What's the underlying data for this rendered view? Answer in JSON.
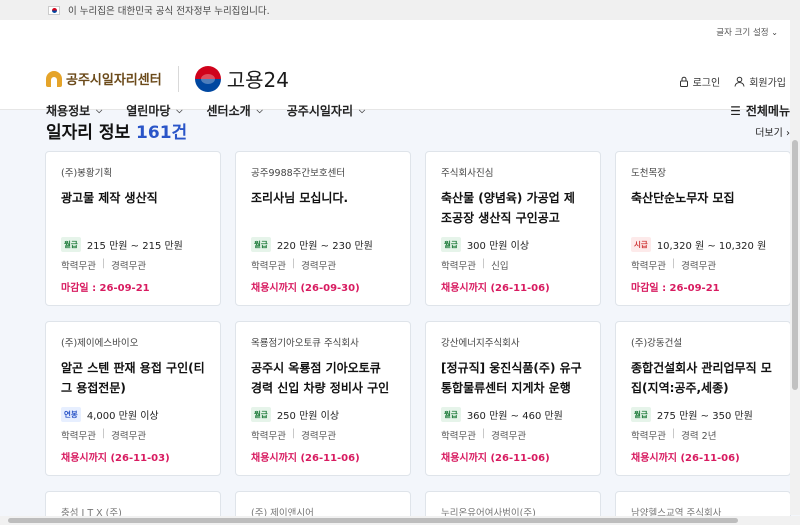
{
  "banner": {
    "text": "이 누리집은 대한민국 공식 전자정부 누리집입니다."
  },
  "header": {
    "font_size_label": "글자 크기 설정",
    "logo_primary": "공주시일자리센터",
    "logo_secondary": "고용24",
    "login_label": "로그인",
    "signup_label": "회원가입"
  },
  "nav": {
    "items": [
      {
        "label": "채용정보"
      },
      {
        "label": "열린마당"
      },
      {
        "label": "센터소개"
      },
      {
        "label": "공주시일자리"
      }
    ],
    "all_menu_label": "전체메뉴"
  },
  "section": {
    "title": "일자리 정보",
    "count": "161건",
    "more_label": "더보기"
  },
  "jobs": [
    {
      "company": "(주)봉황기획",
      "title": "광고물 제작 생산직",
      "pay_type": "월급",
      "pay": "215 만원 ~ 215 만원",
      "education": "학력무관",
      "career": "경력무관",
      "deadline": "마감일 : 26-09-21"
    },
    {
      "company": "공주9988주간보호센터",
      "title": "조리사님 모십니다.",
      "pay_type": "월급",
      "pay": "220 만원 ~ 230 만원",
      "education": "학력무관",
      "career": "경력무관",
      "deadline": "채용시까지 (26-09-30)"
    },
    {
      "company": "주식회사진심",
      "title": "축산물 (양념육) 가공업 제조공장 생산직 구인공고",
      "pay_type": "월급",
      "pay": "300 만원 이상",
      "education": "학력무관",
      "career": "신입",
      "deadline": "채용시까지 (26-11-06)"
    },
    {
      "company": "도천목장",
      "title": "축산단순노무자 모집",
      "pay_type": "시급",
      "pay": "10,320 원 ~ 10,320 원",
      "education": "학력무관",
      "career": "경력무관",
      "deadline": "마감일 : 26-09-21"
    },
    {
      "company": "(주)제이에스바이오",
      "title": "알곤 스텐 판재 용접 구인(티그 용접전문)",
      "pay_type": "연봉",
      "pay": "4,000 만원 이상",
      "education": "학력무관",
      "career": "경력무관",
      "deadline": "채용시까지 (26-11-03)"
    },
    {
      "company": "옥룡점기아오토큐 주식회사",
      "title": "공주시 옥룡점 기아오토큐 경력 신입 차량 정비사 구인",
      "pay_type": "월급",
      "pay": "250 만원 이상",
      "education": "학력무관",
      "career": "경력무관",
      "deadline": "채용시까지 (26-11-06)"
    },
    {
      "company": "강산에너지주식회사",
      "title": "[정규직] 웅진식품(주) 유구통합물류센터 지게차 운행 및 하...",
      "pay_type": "월급",
      "pay": "360 만원 ~ 460 만원",
      "education": "학력무관",
      "career": "경력무관",
      "deadline": "채용시까지 (26-11-06)"
    },
    {
      "company": "(주)강동건설",
      "title": "종합건설회사 관리업무직 모집(지역:공주,세종)",
      "pay_type": "월급",
      "pay": "275 만원 ~ 350 만원",
      "education": "학력무관",
      "career": "경력 2년",
      "deadline": "채용시까지 (26-11-06)"
    }
  ],
  "partial_jobs": [
    {
      "company": "충섬 I T X (주)"
    },
    {
      "company": "(주) 제이앤시어"
    },
    {
      "company": "누리온유어여사범이(주)"
    },
    {
      "company": "남양헬스교역 주식회사"
    }
  ]
}
